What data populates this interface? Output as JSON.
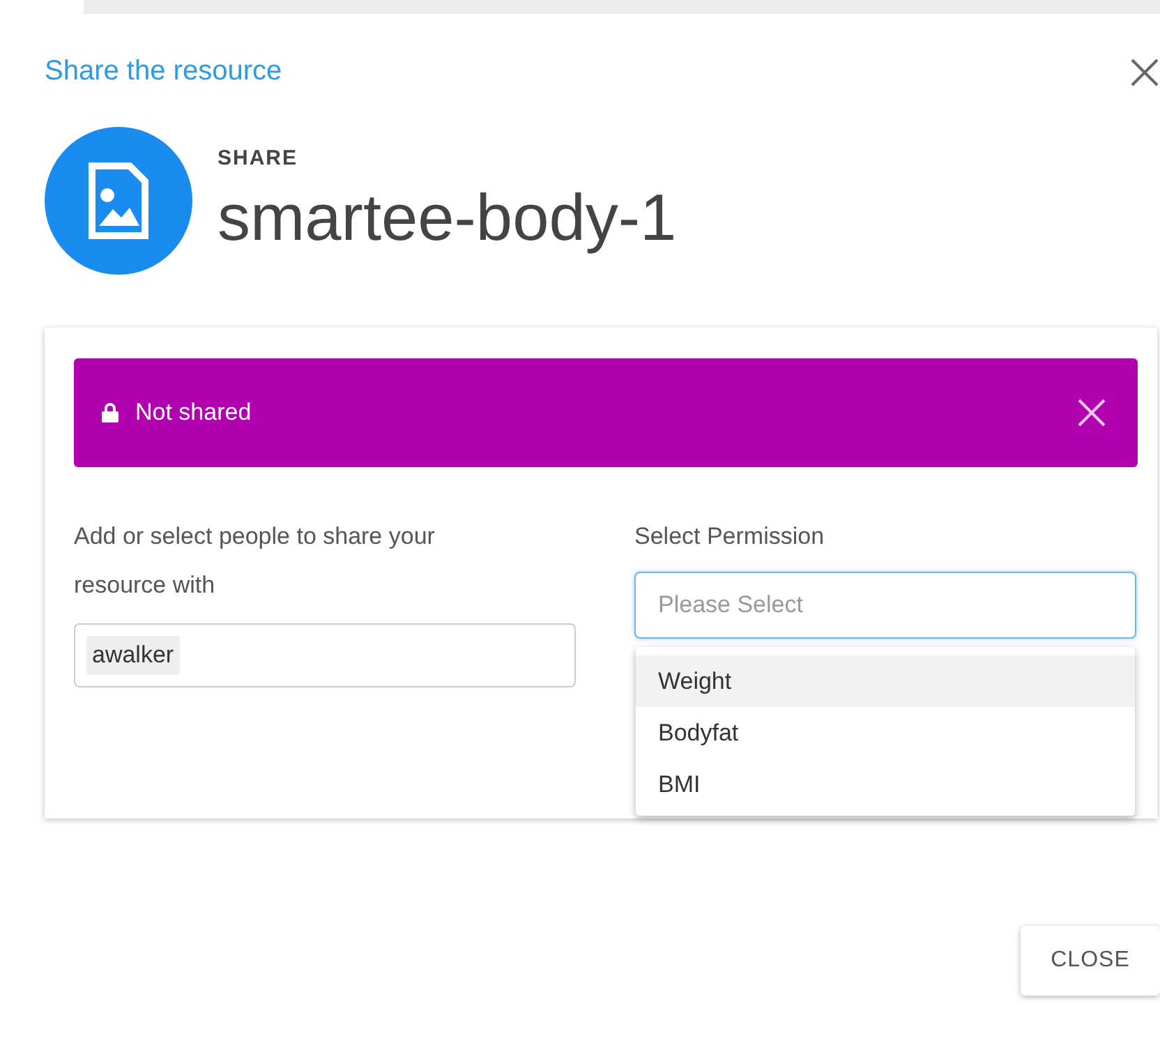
{
  "dialog": {
    "title": "Share the resource",
    "overline": "SHARE",
    "resource_name": "smartee-body-1"
  },
  "banner": {
    "text": "Not shared"
  },
  "people": {
    "label": "Add or select people to share your resource with",
    "chips": [
      "awalker"
    ]
  },
  "permission": {
    "label": "Select Permission",
    "placeholder": "Please Select",
    "focused": true,
    "options": [
      {
        "label": "Weight",
        "selected": true
      },
      {
        "label": "Bodyfat",
        "selected": false
      },
      {
        "label": "BMI",
        "selected": false
      }
    ]
  },
  "buttons": [
    "CLOSE"
  ]
}
